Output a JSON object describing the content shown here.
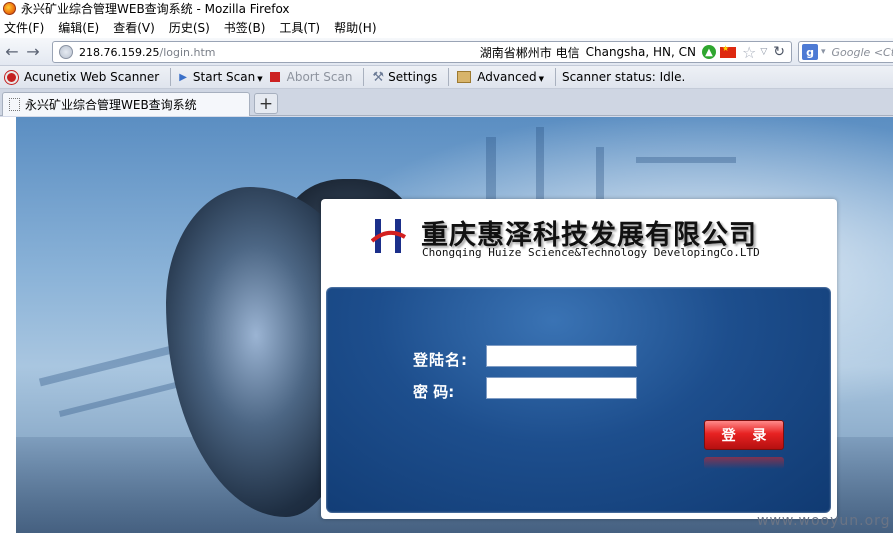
{
  "window": {
    "title": "永兴矿业综合管理WEB查询系统 - Mozilla Firefox"
  },
  "menu": [
    "文件(F)",
    "编辑(E)",
    "查看(V)",
    "历史(S)",
    "书签(B)",
    "工具(T)",
    "帮助(H)"
  ],
  "nav": {
    "url_host": "218.76.159.25",
    "url_path": "/login.htm",
    "geo_region": "湖南省郴州市 电信",
    "geo_city": "Changsha, HN, CN",
    "search_placeholder": "Google <Ct"
  },
  "scanner_toolbar": {
    "name": "Acunetix Web Scanner",
    "start_scan": "Start Scan",
    "abort_scan": "Abort Scan",
    "settings": "Settings",
    "advanced": "Advanced",
    "status": "Scanner status: Idle."
  },
  "tabs": [
    {
      "title": "永兴矿业综合管理WEB查询系统"
    }
  ],
  "page": {
    "company_cn": "重庆惠泽科技发展有限公司",
    "company_en": "Chongqing Huize Science&Technology DevelopingCo.LTD",
    "username_label": "登陆名:",
    "password_label": "密   码:",
    "username_value": "",
    "password_value": "",
    "login_button": "登 录"
  },
  "watermark": "www.wooyun.org",
  "colors": {
    "login_box": "#1d4e8d",
    "login_button": "#e72222",
    "acunetix_red": "#c42020"
  }
}
